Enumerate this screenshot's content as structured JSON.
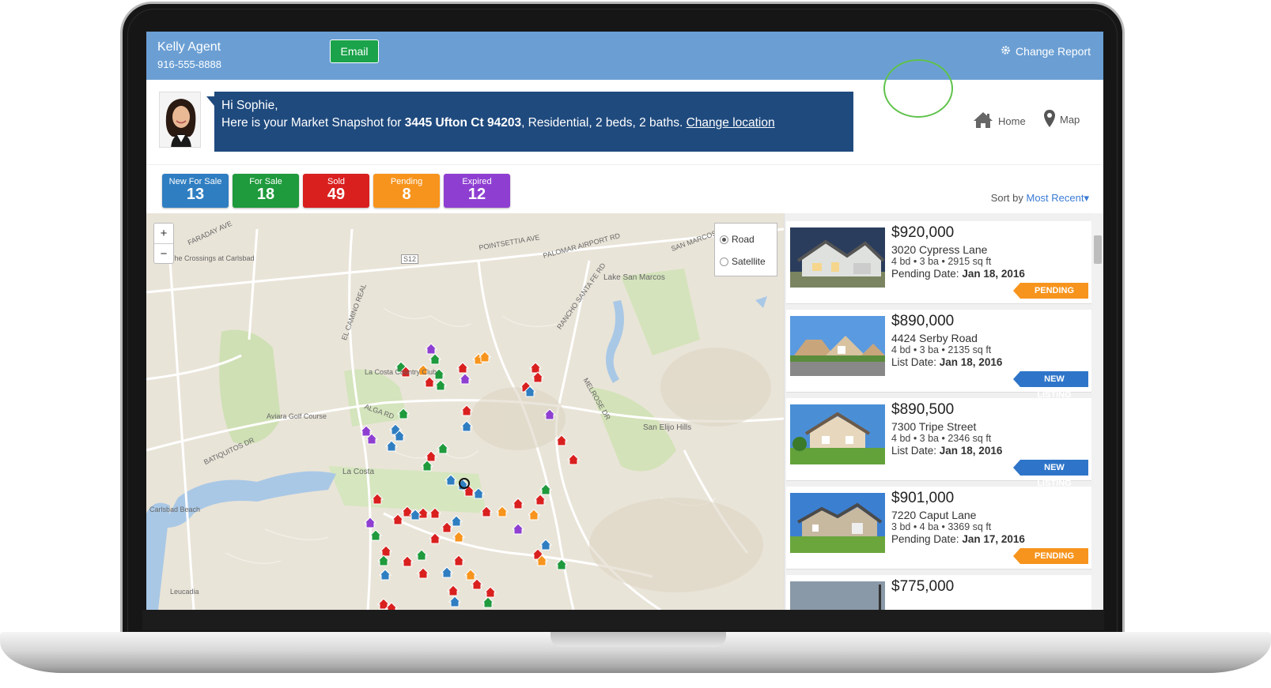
{
  "header": {
    "agent_name": "Kelly Agent",
    "agent_phone": "916-555-8888",
    "email_label": "Email",
    "change_report_label": "Change Report"
  },
  "greeting": {
    "hi": "Hi Sophie,",
    "lead": "Here is your Market Snapshot for ",
    "address": "3445 Ufton Ct 94203",
    "details": ", Residential, 2 beds, 2 baths. ",
    "change_location": "Change location"
  },
  "nav": {
    "home": "Home",
    "map": "Map"
  },
  "stats": [
    {
      "label": "New For Sale",
      "value": "13",
      "color": "#2f7ec1"
    },
    {
      "label": "For Sale",
      "value": "18",
      "color": "#1f9a3c"
    },
    {
      "label": "Sold",
      "value": "49",
      "color": "#d9201f"
    },
    {
      "label": "Pending",
      "value": "8",
      "color": "#f7941d"
    },
    {
      "label": "Expired",
      "value": "12",
      "color": "#8e3fd1"
    }
  ],
  "sort": {
    "prefix": "Sort by ",
    "value": "Most Recent"
  },
  "map": {
    "zoom_in": "+",
    "zoom_out": "−",
    "type_road": "Road",
    "type_satellite": "Satellite",
    "labels": [
      "FARADAY AVE",
      "POINTSETTIA AVE",
      "PALOMAR AIRPORT RD",
      "SAN MARCOS",
      "Lake San Marcos",
      "La Costa Country Club",
      "Aviara Golf Course",
      "La Costa",
      "San Elijo Hills",
      "Carlsbad Beach",
      "Leucadia",
      "ALGA RD",
      "EL CAMINO REAL",
      "MELROSE DR",
      "RANCHO SANTA FE RD",
      "BATIQUITOS DR",
      "The Crossings at Carlsbad",
      "S12"
    ]
  },
  "listings": [
    {
      "price": "$920,000",
      "address": "3020 Cypress Lane",
      "bd": "4",
      "ba": "3",
      "sqft": "2915",
      "date_label": "Pending Date: ",
      "date": "Jan 18, 2016",
      "badge": "PENDING"
    },
    {
      "price": "$890,000",
      "address": "4424 Serby Road",
      "bd": "4",
      "ba": "3",
      "sqft": "2135",
      "date_label": "List Date: ",
      "date": "Jan 18, 2016",
      "badge": "NEW LISTING"
    },
    {
      "price": "$890,500",
      "address": "7300 Tripe Street",
      "bd": "4",
      "ba": "3",
      "sqft": "2346",
      "date_label": "List Date: ",
      "date": "Jan 18, 2016",
      "badge": "NEW LISTING"
    },
    {
      "price": "$901,000",
      "address": "7220 Caput Lane",
      "bd": "3",
      "ba": "4",
      "sqft": "3369",
      "date_label": "Pending Date: ",
      "date": "Jan 17, 2016",
      "badge": "PENDING"
    },
    {
      "price": "$775,000"
    }
  ],
  "units": {
    "bd": "bd",
    "ba": "ba",
    "sqft": "sq ft"
  }
}
